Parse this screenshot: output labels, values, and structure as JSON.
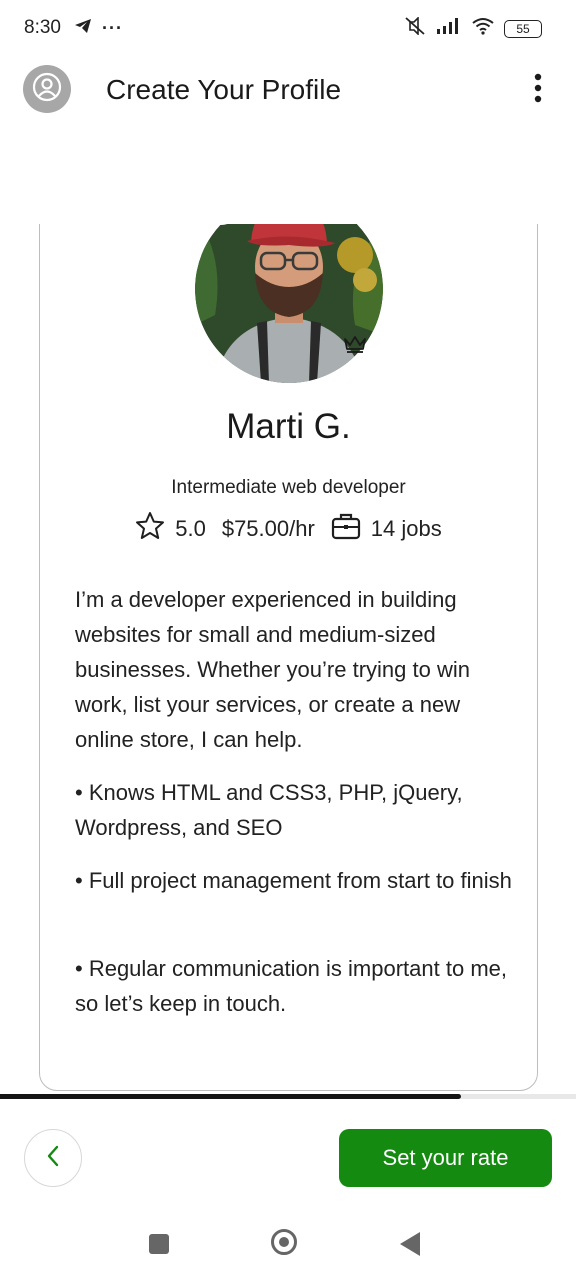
{
  "status_bar": {
    "time": "8:30",
    "battery": "55",
    "left_icons": [
      "telegram-icon",
      "more-dots-icon"
    ],
    "right_icons": [
      "mute-icon",
      "signal-icon",
      "wifi-icon",
      "battery-icon"
    ]
  },
  "app_bar": {
    "title": "Create Your Profile"
  },
  "profile": {
    "name": "Marti G.",
    "headline": "Intermediate web developer",
    "rating": "5.0",
    "rate": "$75.00/hr",
    "jobs": "14 jobs",
    "bio": "I’m a developer experienced in building websites for small and medium-sized businesses. Whether you’re trying to win work, list your services, or create a new online store, I can help.",
    "bullets": [
      "•  Knows HTML and CSS3, PHP, jQuery, Wordpress, and SEO",
      "•  Full project management from start to finish",
      "•  Regular communication is important to me, so let’s keep in touch."
    ]
  },
  "progress": {
    "fraction": 0.8
  },
  "footer": {
    "back_label": "‹",
    "next_label": "Set your rate"
  },
  "colors": {
    "primary_green": "#148a11",
    "online_green": "#3c9b3a"
  }
}
